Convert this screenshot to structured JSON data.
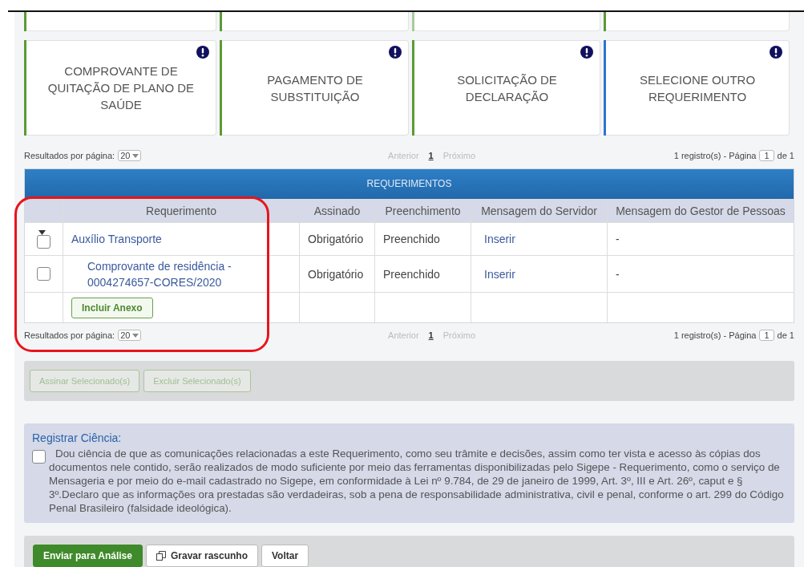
{
  "top_cards": [
    {
      "color": "#5b9a35"
    },
    {
      "color": "#5b9a35"
    },
    {
      "color": "#a8cc9a"
    },
    {
      "color": "#5b9a35"
    }
  ],
  "cards": [
    {
      "title": "COMPROVANTE DE QUITAÇÃO DE PLANO DE SAÚDE",
      "color": "#5b9a35"
    },
    {
      "title": "PAGAMENTO DE SUBSTITUIÇÃO",
      "color": "#5b9a35"
    },
    {
      "title": "SOLICITAÇÃO DE DECLARAÇÃO",
      "color": "#5b9a35"
    },
    {
      "title": "SELECIONE OUTRO REQUERIMENTO",
      "color": "#2f74d0"
    }
  ],
  "pager_top": {
    "label": "Resultados por página:",
    "per_page": "20",
    "prev": "Anterior",
    "page": "1",
    "next": "Próximo",
    "summary": "1 registro(s) - Página",
    "page_input": "1",
    "total": "de 1"
  },
  "table": {
    "title": "REQUERIMENTOS",
    "columns": [
      "Requerimento",
      "Assinado",
      "Preenchimento",
      "Mensagem do Servidor",
      "Mensagem do Gestor de Pessoas"
    ],
    "rows": [
      {
        "kind": "parent",
        "expanded": true,
        "checked": false,
        "name": "Auxílio Transporte",
        "signed": "Obrigatório",
        "filled": "Preenchido",
        "message": "Inserir",
        "manager": "-"
      },
      {
        "kind": "child",
        "checked": false,
        "name": "Comprovante de residência - 0004274657-CORES/2020",
        "signed": "Obrigatório",
        "filled": "Preenchido",
        "message": "Inserir",
        "manager": "-"
      },
      {
        "kind": "attach",
        "button": "Incluir Anexo"
      }
    ]
  },
  "pager_bottom": {
    "label": "Resultados por página:",
    "per_page": "20",
    "prev": "Anterior",
    "page": "1",
    "next": "Próximo",
    "summary": "1 registro(s) - Página",
    "page_input": "1",
    "total": "de 1"
  },
  "highlight": {
    "color": "#e8141c"
  },
  "bulk_actions": [
    {
      "label": "Assinar Selecionado(s)",
      "disabled": true
    },
    {
      "label": "Excluir Selecionado(s)",
      "disabled": true
    }
  ],
  "acknowledgement": {
    "title": "Registrar Ciência:",
    "checked": false,
    "text": "Dou ciência de que as comunicações relacionadas a este Requerimento, como seu trâmite e decisões, assim como ter vista e acesso às cópias dos documentos nele contido, serão realizados de modo suficiente por meio das ferramentas disponibilizadas pelo Sigepe - Requerimento, como o serviço de Mensageria e por meio do e-mail cadastrado no Sigepe, em conformidade à Lei nº 9.784, de 29 de janeiro de 1999, Art. 3º, III e Art. 26º, caput e § 3º.Declaro que as informações ora prestadas são verdadeiras, sob a pena de responsabilidade administrativa, civil e penal, conforme o art. 299 do Código Penal Brasileiro (falsidade ideológica)."
  },
  "footer_buttons": [
    {
      "label": "Enviar para Análise",
      "kind": "primary"
    },
    {
      "label": "Gravar rascunho",
      "kind": "draft"
    },
    {
      "label": "Voltar",
      "kind": "default"
    }
  ]
}
